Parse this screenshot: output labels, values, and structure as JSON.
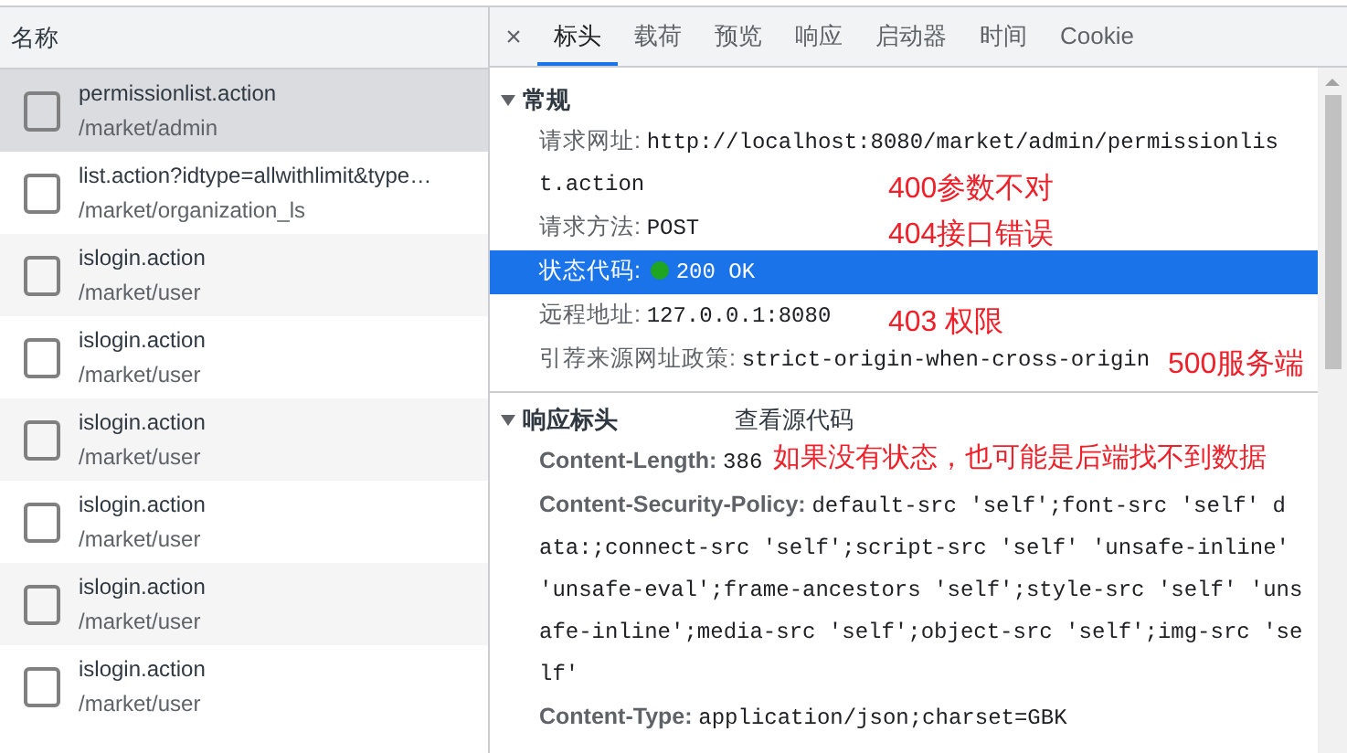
{
  "request_list": {
    "header": "名称",
    "rows": [
      {
        "name": "permissionlist.action",
        "path": "/market/admin",
        "selected": true
      },
      {
        "name": "list.action?idtype=allwithlimit&type…",
        "path": "/market/organization_ls",
        "selected": false
      },
      {
        "name": "islogin.action",
        "path": "/market/user",
        "selected": false
      },
      {
        "name": "islogin.action",
        "path": "/market/user",
        "selected": false
      },
      {
        "name": "islogin.action",
        "path": "/market/user",
        "selected": false
      },
      {
        "name": "islogin.action",
        "path": "/market/user",
        "selected": false
      },
      {
        "name": "islogin.action",
        "path": "/market/user",
        "selected": false
      },
      {
        "name": "islogin.action",
        "path": "/market/user",
        "selected": false
      }
    ]
  },
  "detail": {
    "close": "×",
    "tabs": [
      {
        "label": "标头",
        "selected": true
      },
      {
        "label": "载荷",
        "selected": false
      },
      {
        "label": "预览",
        "selected": false
      },
      {
        "label": "响应",
        "selected": false
      },
      {
        "label": "启动器",
        "selected": false
      },
      {
        "label": "时间",
        "selected": false
      },
      {
        "label": "Cookie",
        "selected": false
      }
    ],
    "sections": [
      {
        "title": "常规",
        "expanded": true,
        "rows": [
          {
            "kind": "plain",
            "label": "请求网址:",
            "value": [
              "http://localhost:8080/market/admin/permissionlis",
              "t.action"
            ],
            "selected": false
          },
          {
            "kind": "plain",
            "label": "请求方法:",
            "value": [
              "POST"
            ],
            "selected": false
          },
          {
            "kind": "status",
            "label": "状态代码:",
            "value": [
              "200 OK"
            ],
            "selected": true,
            "color": "#1fa51f"
          },
          {
            "kind": "plain",
            "label": "远程地址:",
            "value": [
              "127.0.0.1:8080"
            ],
            "selected": false
          },
          {
            "kind": "plain",
            "label": "引荐来源网址政策:",
            "value": [
              "strict-origin-when-cross-origin"
            ],
            "selected": false
          }
        ]
      },
      {
        "title": "响应标头",
        "expanded": true,
        "link": "查看源代码",
        "rows": [
          {
            "kind": "header",
            "label": "Content-Length:",
            "value": [
              "386"
            ],
            "selected": false
          },
          {
            "kind": "header",
            "label": "Content-Security-Policy:",
            "value": [
              "default-src 'self';font-src 'self' d",
              "ata:;connect-src 'self';script-src 'self' 'unsafe-inline'",
              "'unsafe-eval';frame-ancestors 'self';style-src 'self' 'uns",
              "afe-inline';media-src 'self';object-src 'self';img-src 'se",
              "lf'"
            ],
            "selected": false
          },
          {
            "kind": "header",
            "label": "Content-Type:",
            "value": [
              "application/json;charset=GBK"
            ],
            "selected": false
          }
        ]
      }
    ]
  },
  "annotations": [
    {
      "text": "400参数不对"
    },
    {
      "text": "404接口错误"
    },
    {
      "text": "403 权限"
    },
    {
      "text": "500服务端"
    },
    {
      "text": "如果没有状态，也可能是后端找不到数据"
    }
  ]
}
